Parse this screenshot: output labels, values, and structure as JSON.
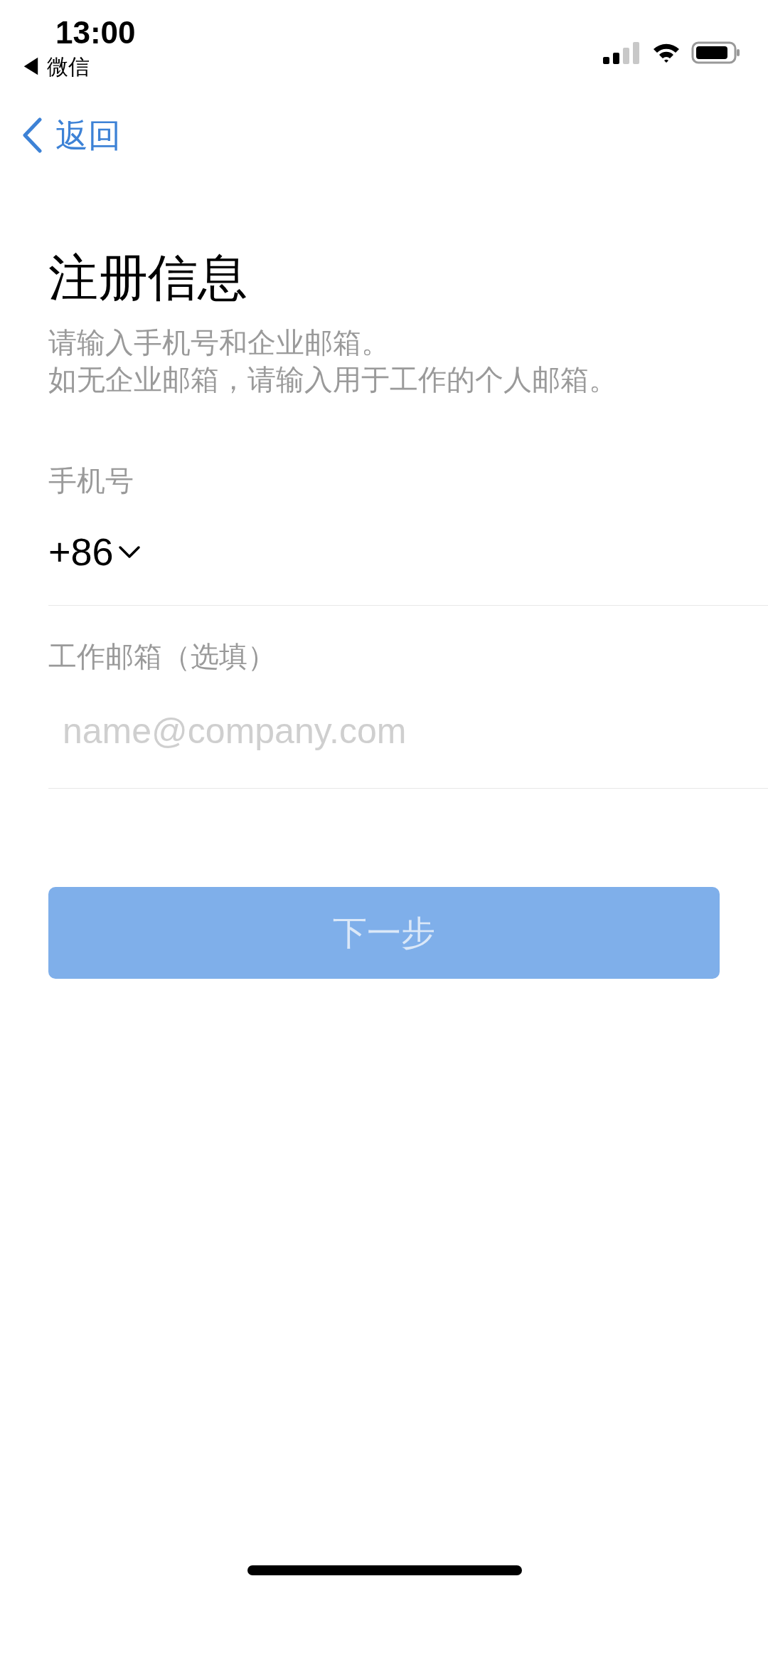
{
  "status_bar": {
    "time": "13:00",
    "back_app": "◀ 微信"
  },
  "nav": {
    "back": "返回"
  },
  "title": "注册信息",
  "subtitle": [
    "请输入手机号和企业邮箱。",
    "如无企业邮箱，请输入用于工作的个人邮箱。"
  ],
  "phone": {
    "label": "手机号",
    "country_code": "+86"
  },
  "email": {
    "label": "工作邮箱（选填）",
    "placeholder": "name@company.com"
  },
  "next_button": {
    "label": "下一步",
    "disabled": true
  }
}
